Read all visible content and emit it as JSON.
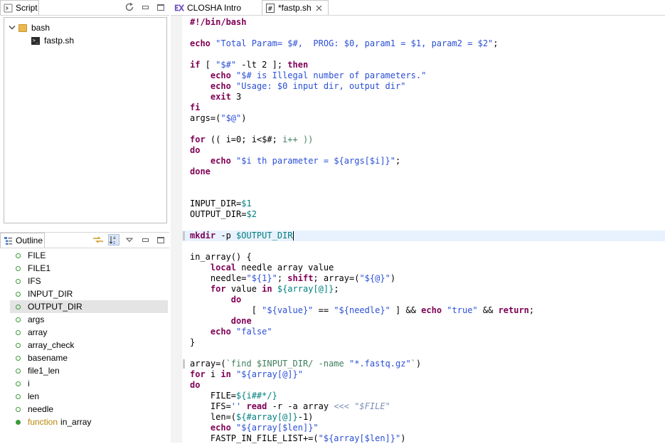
{
  "script_view": {
    "tab_label": "Script",
    "tree": {
      "folder": "bash",
      "file": "fastp.sh"
    }
  },
  "outline_view": {
    "tab_label": "Outline",
    "items": [
      {
        "label": "FILE"
      },
      {
        "label": "FILE1"
      },
      {
        "label": "IFS"
      },
      {
        "label": "INPUT_DIR"
      },
      {
        "label": "OUTPUT_DIR",
        "selected": true
      },
      {
        "label": "args"
      },
      {
        "label": "array"
      },
      {
        "label": "array_check"
      },
      {
        "label": "basename"
      },
      {
        "label": "file1_len"
      },
      {
        "label": "i"
      },
      {
        "label": "len"
      },
      {
        "label": "needle"
      },
      {
        "label": "in_array",
        "prefix": "function"
      }
    ]
  },
  "editor": {
    "tabs": [
      {
        "label": "CLOSHA Intro",
        "active": false
      },
      {
        "label": "*fastp.sh",
        "active": true
      }
    ],
    "highlight_line": 21,
    "lines": [
      [
        [
          "k",
          "#!/bin/bash"
        ]
      ],
      [],
      [
        [
          "k",
          "echo"
        ],
        [
          "p",
          " "
        ],
        [
          "s",
          "\"Total Param= $#,  PROG: $0, param1 = $1, param2 = $2\""
        ],
        [
          "p",
          ";"
        ]
      ],
      [],
      [
        [
          "k",
          "if"
        ],
        [
          "p",
          " [ "
        ],
        [
          "s",
          "\"$#\""
        ],
        [
          "p",
          " -lt 2 ]; "
        ],
        [
          "k",
          "then"
        ]
      ],
      [
        [
          "p",
          "    "
        ],
        [
          "k",
          "echo"
        ],
        [
          "p",
          " "
        ],
        [
          "s",
          "\"$# is Illegal number of parameters.\""
        ]
      ],
      [
        [
          "p",
          "    "
        ],
        [
          "k",
          "echo"
        ],
        [
          "p",
          " "
        ],
        [
          "s",
          "\"Usage: $0 input dir, output dir\""
        ]
      ],
      [
        [
          "p",
          "    "
        ],
        [
          "k",
          "exit"
        ],
        [
          "p",
          " 3"
        ]
      ],
      [
        [
          "k",
          "fi"
        ]
      ],
      [
        [
          "p",
          "args=("
        ],
        [
          "s",
          "\"$@\""
        ],
        [
          "p",
          ")"
        ]
      ],
      [],
      [
        [
          "k",
          "for"
        ],
        [
          "p",
          " (( i=0; i<$#; "
        ],
        [
          "c",
          "i++ ))"
        ]
      ],
      [
        [
          "k",
          "do"
        ]
      ],
      [
        [
          "p",
          "    "
        ],
        [
          "k",
          "echo"
        ],
        [
          "p",
          " "
        ],
        [
          "s",
          "\"$i th parameter = ${args[$i]}\""
        ],
        [
          "p",
          ";"
        ]
      ],
      [
        [
          "k",
          "done"
        ]
      ],
      [],
      [],
      [
        [
          "p",
          "INPUT_DIR="
        ],
        [
          "v",
          "$1"
        ]
      ],
      [
        [
          "p",
          "OUTPUT_DIR="
        ],
        [
          "v",
          "$2"
        ]
      ],
      [],
      [
        [
          "k",
          "mkdir"
        ],
        [
          "p",
          " -p "
        ],
        [
          "v",
          "$OUTPUT_DIR"
        ],
        [
          "cursor",
          ""
        ]
      ],
      [],
      [
        [
          "p",
          "in_array() {"
        ]
      ],
      [
        [
          "p",
          "    "
        ],
        [
          "k",
          "local"
        ],
        [
          "p",
          " needle array value"
        ]
      ],
      [
        [
          "p",
          "    needle="
        ],
        [
          "s",
          "\"${1}\""
        ],
        [
          "p",
          "; "
        ],
        [
          "k",
          "shift"
        ],
        [
          "p",
          "; array=("
        ],
        [
          "s",
          "\"${@}\""
        ],
        [
          "p",
          ")"
        ]
      ],
      [
        [
          "p",
          "    "
        ],
        [
          "k",
          "for"
        ],
        [
          "p",
          " value "
        ],
        [
          "k",
          "in"
        ],
        [
          "p",
          " "
        ],
        [
          "v",
          "${array[@]}"
        ],
        [
          "p",
          ";"
        ]
      ],
      [
        [
          "p",
          "        "
        ],
        [
          "k",
          "do"
        ]
      ],
      [
        [
          "p",
          "            [ "
        ],
        [
          "s",
          "\"${value}\""
        ],
        [
          "p",
          " == "
        ],
        [
          "s",
          "\"${needle}\""
        ],
        [
          "p",
          " ] && "
        ],
        [
          "k",
          "echo"
        ],
        [
          "p",
          " "
        ],
        [
          "s",
          "\"true\""
        ],
        [
          "p",
          " && "
        ],
        [
          "k",
          "return"
        ],
        [
          "p",
          ";"
        ]
      ],
      [
        [
          "p",
          "        "
        ],
        [
          "k",
          "done"
        ]
      ],
      [
        [
          "p",
          "    "
        ],
        [
          "k",
          "echo"
        ],
        [
          "p",
          " "
        ],
        [
          "s",
          "\"false\""
        ]
      ],
      [
        [
          "p",
          "}"
        ]
      ],
      [],
      [
        [
          "p",
          "array=("
        ],
        [
          "c",
          "`find $INPUT_DIR/ -name "
        ],
        [
          "s",
          "\"*.fastq.gz\""
        ],
        [
          "c",
          "`"
        ],
        [
          "p",
          ")"
        ]
      ],
      [
        [
          "k",
          "for"
        ],
        [
          "p",
          " i "
        ],
        [
          "k",
          "in"
        ],
        [
          "p",
          " "
        ],
        [
          "s",
          "\"${array[@]}\""
        ]
      ],
      [
        [
          "k",
          "do"
        ]
      ],
      [
        [
          "p",
          "    FILE="
        ],
        [
          "v",
          "${i##*/}"
        ]
      ],
      [
        [
          "p",
          "    IFS="
        ],
        [
          "s",
          "''"
        ],
        [
          "p",
          " "
        ],
        [
          "k",
          "read"
        ],
        [
          "p",
          " -r -a array "
        ],
        [
          "it",
          "<<< \"$FILE\""
        ]
      ],
      [
        [
          "p",
          "    len=("
        ],
        [
          "v",
          "${#array[@]}"
        ],
        [
          "p",
          "-1)"
        ]
      ],
      [
        [
          "p",
          "    "
        ],
        [
          "k",
          "echo"
        ],
        [
          "p",
          " "
        ],
        [
          "s",
          "\"${array[$len]}\""
        ]
      ],
      [
        [
          "p",
          "    FASTP_IN_FILE_LIST+=("
        ],
        [
          "s",
          "\"${array[$len]}\""
        ],
        [
          "p",
          ")"
        ]
      ]
    ]
  }
}
